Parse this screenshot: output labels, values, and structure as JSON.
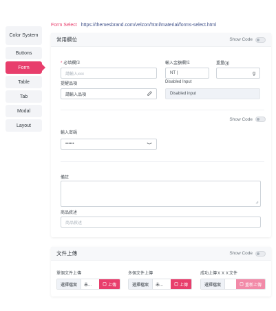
{
  "sidebar": {
    "items": [
      {
        "label": "Color System"
      },
      {
        "label": "Buttons"
      },
      {
        "label": "Form"
      },
      {
        "label": "Table"
      },
      {
        "label": "Tab"
      },
      {
        "label": "Modal"
      },
      {
        "label": "Layout"
      }
    ],
    "active_index": 2
  },
  "topline": {
    "title": "Form Select",
    "url": "https://themesbrand.com/velzon/html/material/forms-select.html"
  },
  "card_common": {
    "title": "常用欄位",
    "showcode": "Show Code",
    "required_label": "必填欄位",
    "required_placeholder": "請輸入xxx",
    "amount_label": "輸入金額欄位",
    "amount_value": "NT |",
    "weight_label": "重量(g)",
    "weight_unit": "g",
    "hint_label": "提醒品項",
    "hint_placeholder": "請輸入品項",
    "disabled_label": "Disabled Input",
    "disabled_value": "Disabled input",
    "showcode2": "Show Code",
    "password_label": "輸入密碼",
    "password_value": "••••••",
    "note_label": "備註",
    "desc_label": "商品敘述",
    "desc_placeholder": "商品敘述"
  },
  "card_upload": {
    "title": "文件上傳",
    "showcode": "Show Code",
    "single": {
      "label": "單個文件上傳",
      "choose": "選擇檔案",
      "fname": "未...",
      "btn": "上傳"
    },
    "multi": {
      "label": "多個文件上傳",
      "choose": "選擇檔案",
      "fname": "未...",
      "btn": "上傳"
    },
    "success": {
      "label": "成功上傳ＸＸＸ文件",
      "choose": "選擇檔案",
      "fname": "",
      "btn": "重新上傳"
    }
  },
  "colors": {
    "accent": "#e83e6c",
    "link": "#405189"
  }
}
